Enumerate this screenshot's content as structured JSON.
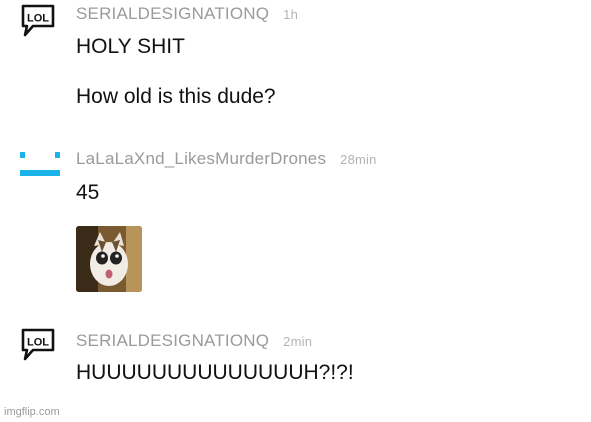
{
  "comments": [
    {
      "username": "SERIALDESIGNATIONQ",
      "time": "1h",
      "avatar_icon": "lol-speech-bubble-icon",
      "avatar_text": "LOL",
      "lines": [
        "HOLY SHIT",
        "How old is this dude?"
      ]
    },
    {
      "username": "LaLaLaXnd_LikesMurderDrones",
      "time": "28min",
      "avatar_icon": "drone-face-icon",
      "avatar_color": "#1ab3e6",
      "lines": [
        "45"
      ],
      "image": "shocked-cat-image"
    },
    {
      "username": "SERIALDESIGNATIONQ",
      "time": "2min",
      "avatar_icon": "lol-speech-bubble-icon",
      "avatar_text": "LOL",
      "lines": [
        "HUUUUUUUUUUUUUUH?!?!"
      ]
    }
  ],
  "watermark": "imgflip.com"
}
